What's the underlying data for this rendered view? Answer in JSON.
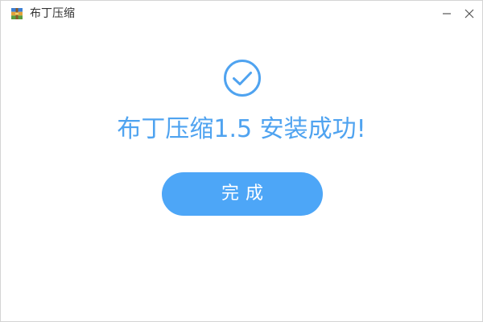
{
  "window": {
    "title": "布丁压缩",
    "app_icon": "archive-app-icon",
    "controls": {
      "minimize_icon": "minimize-icon",
      "close_icon": "close-icon"
    }
  },
  "main": {
    "status_icon": "check-circle-icon",
    "headline": "布丁压缩1.5 安装成功!",
    "done_label": "完成"
  },
  "colors": {
    "accent": "#4fa3f0",
    "button": "#4da6f7",
    "button_text": "#ffffff",
    "title_text": "#333333"
  }
}
